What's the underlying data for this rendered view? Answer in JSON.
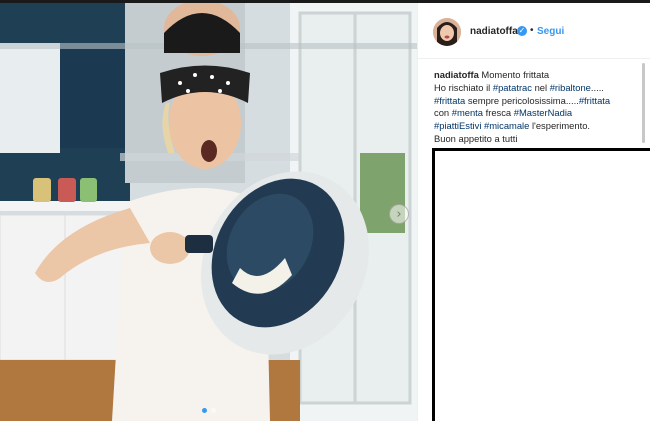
{
  "post": {
    "username": "nadiatoffa",
    "follow_label": "Segui",
    "bullet": "•",
    "verified_icon": "✓",
    "next_icon": "›",
    "caption_lines": [
      [
        {
          "t": "nadiatoffa ",
          "c": "uname"
        },
        {
          "t": "Momento frittata",
          "c": ""
        }
      ],
      [
        {
          "t": "Ho rischiato il ",
          "c": ""
        },
        {
          "t": "#patatrac",
          "c": "tag"
        },
        {
          "t": " nel ",
          "c": ""
        },
        {
          "t": "#ribaltone",
          "c": "tag"
        },
        {
          "t": ".....",
          "c": ""
        }
      ],
      [
        {
          "t": "#frittata",
          "c": "tag"
        },
        {
          "t": " sempre pericolosissima.....",
          "c": ""
        },
        {
          "t": "#frittata",
          "c": "tag"
        }
      ],
      [
        {
          "t": "con ",
          "c": ""
        },
        {
          "t": "#menta",
          "c": "tag"
        },
        {
          "t": " fresca ",
          "c": ""
        },
        {
          "t": "#MasterNadia",
          "c": "tag"
        }
      ],
      [
        {
          "t": "#piattiEstivi",
          "c": "tag"
        },
        {
          "t": " ",
          "c": ""
        },
        {
          "t": "#micamale",
          "c": "tag"
        },
        {
          "t": " l'esperimento.",
          "c": ""
        }
      ],
      [
        {
          "t": "Buon appetito a tutti",
          "c": ""
        }
      ]
    ],
    "carousel": {
      "count": 2,
      "active": 0
    }
  },
  "colors": {
    "link": "#003569",
    "accent": "#3897f0"
  }
}
